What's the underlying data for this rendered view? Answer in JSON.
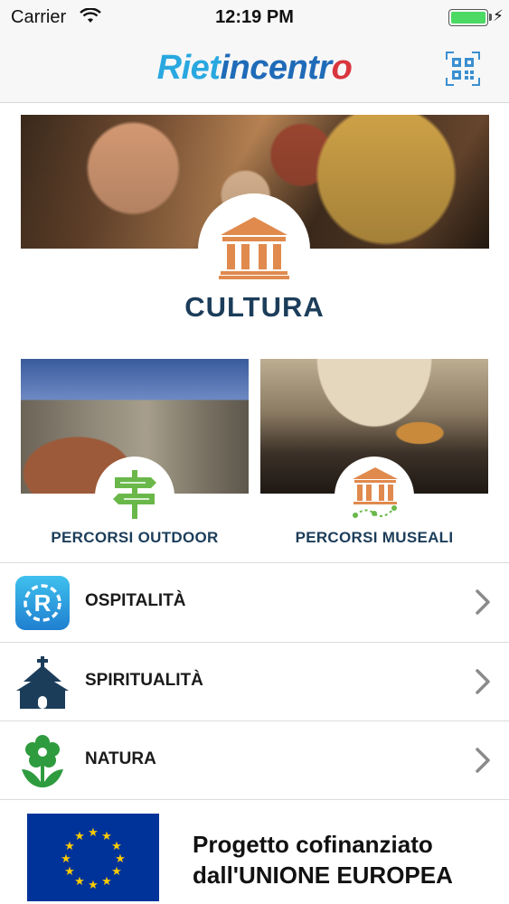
{
  "status_bar": {
    "carrier": "Carrier",
    "time": "12:19 PM"
  },
  "header": {
    "logo_part1": "Riet",
    "logo_part2": "incentr",
    "logo_part3": "o"
  },
  "hero": {
    "title": "CULTURA",
    "icon": "temple-icon"
  },
  "tiles": [
    {
      "label": "PERCORSI OUTDOOR",
      "icon": "signpost-icon"
    },
    {
      "label": "PERCORSI MUSEALI",
      "icon": "museum-route-icon"
    }
  ],
  "list": [
    {
      "label": "OSPITALITÀ",
      "icon": "hospitality-r-icon"
    },
    {
      "label": "SPIRITUALITÀ",
      "icon": "church-icon"
    },
    {
      "label": "NATURA",
      "icon": "flower-icon"
    }
  ],
  "footer": {
    "line1": "Progetto cofinanziato",
    "line2": "dall'UNIONE EUROPEA"
  },
  "colors": {
    "title": "#1c3d5a",
    "accent_orange": "#e08a4e",
    "accent_green": "#6ab84a",
    "eu_blue": "#003399",
    "eu_star": "#ffcc00"
  }
}
